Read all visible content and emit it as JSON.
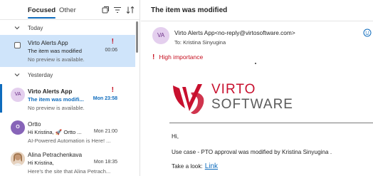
{
  "tabs": {
    "focused": "Focused",
    "other": "Other"
  },
  "toolbar": {
    "icons": [
      "select-messages-icon",
      "filter-icon",
      "sort-icon"
    ]
  },
  "groups": {
    "today": "Today",
    "yesterday": "Yesterday"
  },
  "messages": [
    {
      "sender": "Virto Alerts App",
      "subject": "The item was modified",
      "preview": "No preview is available.",
      "time": "00:06",
      "important": true,
      "selected": true,
      "unread": false
    },
    {
      "avatar": "VA",
      "sender": "Virto Alerts App",
      "subject": "The item was modifi...",
      "preview": "No preview is available.",
      "time": "Mon 23:58",
      "important": true,
      "unread": true
    },
    {
      "avatar": "O",
      "sender": "Ortto",
      "subject": "Hi Kristina, 🚀 Ortto ...",
      "preview": "AI-Powered Automation is Here! ...",
      "time": "Mon 21:00",
      "unread": false
    },
    {
      "sender": "Alina Petrachenkava",
      "subject": "Hi Kristina,",
      "preview": "Here's the site that Alina Petrach...",
      "time": "Mon 18:35",
      "unread": false
    }
  ],
  "reading_pane": {
    "title": "The item was modified",
    "avatar": "VA",
    "from": "Virto Alerts App<no-reply@virtosoftware.com>",
    "to_label": "To:",
    "to": "Kristina Sinyugina",
    "importance": "High importance",
    "logo": {
      "line1": "VIRTO",
      "line2": "SOFTWARE"
    },
    "body": {
      "greeting": "Hi,",
      "line1": "Use case - PTO approval was modified by Kristina Sinyugina .",
      "take_a_look": "Take a look:",
      "link": "Link"
    }
  },
  "colors": {
    "accent": "#0f6cbd",
    "selected": "#cfe4fa",
    "importance": "#c50f1f",
    "brand_red": "#c8102e"
  }
}
